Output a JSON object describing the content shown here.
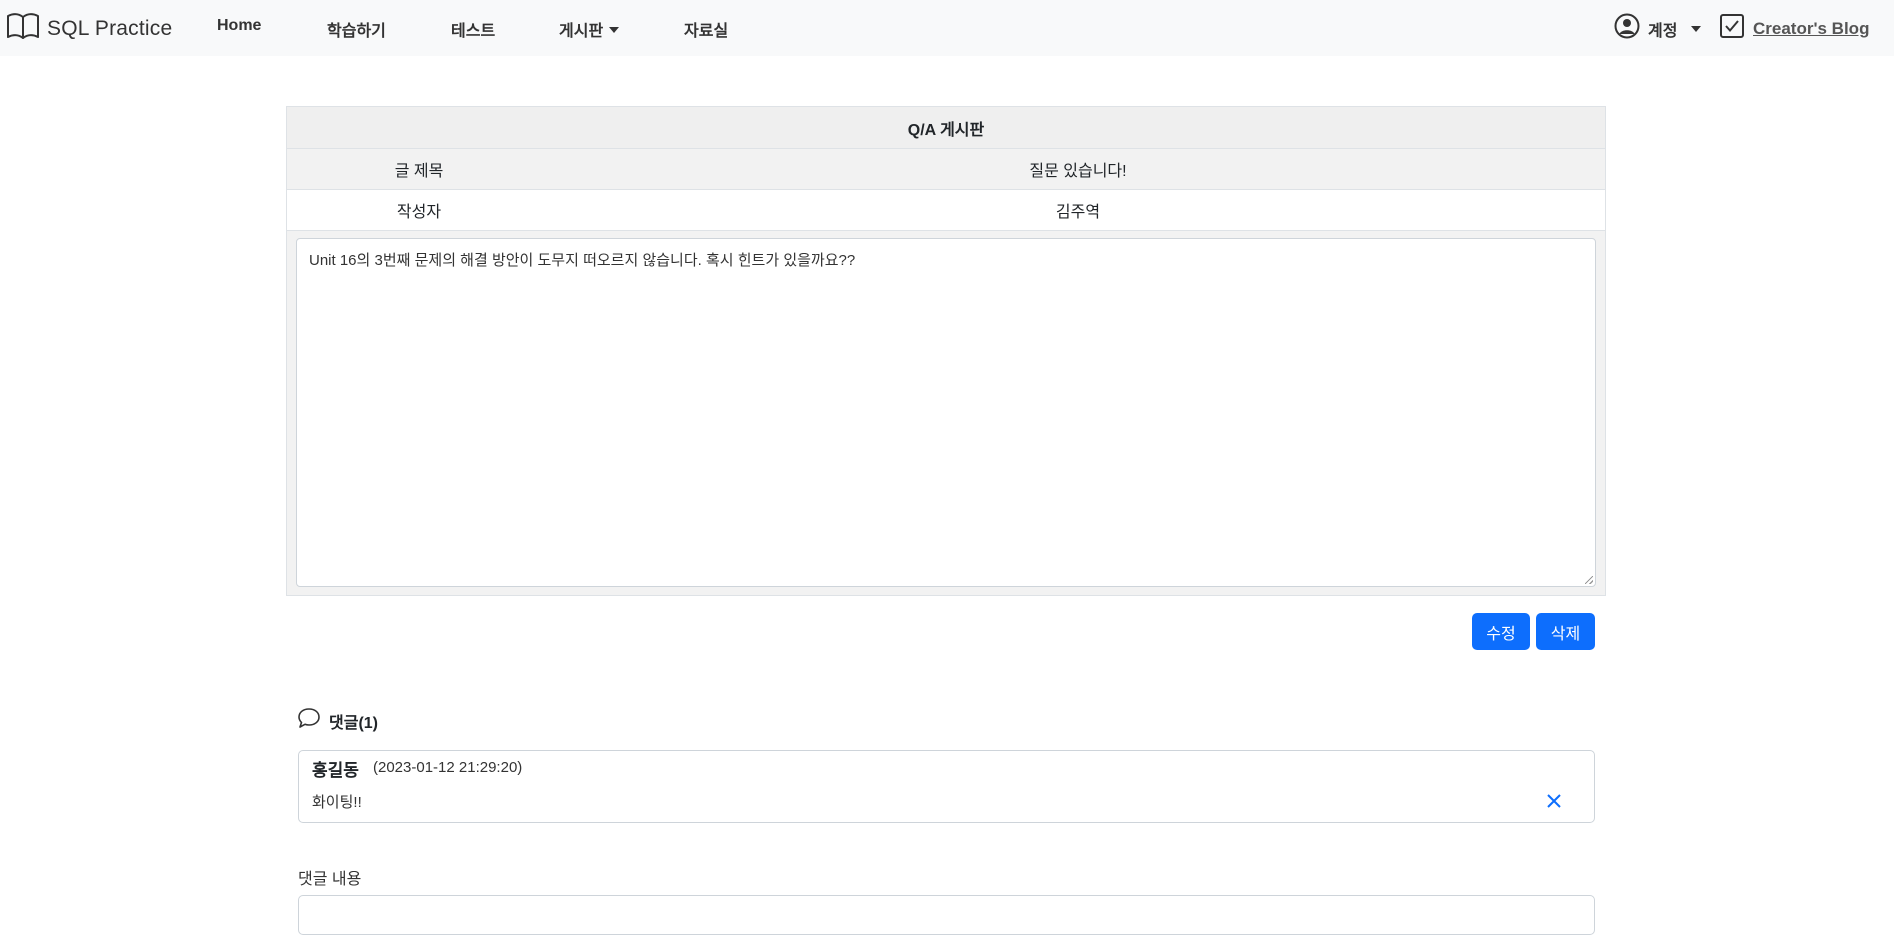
{
  "navbar": {
    "brand": "SQL Practice",
    "items": [
      {
        "label": "Home"
      },
      {
        "label": "학습하기"
      },
      {
        "label": "테스트"
      },
      {
        "label": "게시판"
      },
      {
        "label": "자료실"
      }
    ],
    "account_label": "계정",
    "blog_label": "Creator's Blog"
  },
  "board": {
    "title": "Q/A 게시판",
    "subject_label": "글 제목",
    "subject_value": "질문 있습니다!",
    "author_label": "작성자",
    "author_value": "김주역",
    "content": "Unit 16의 3번째 문제의 해결 방안이 도무지 떠오르지 않습니다. 혹시 힌트가 있을까요??"
  },
  "actions": {
    "edit_label": "수정",
    "delete_label": "삭제"
  },
  "comments": {
    "header": "댓글(1)",
    "items": [
      {
        "author": "홍길동",
        "date": "(2023-01-12 21:29:20)",
        "text": "화이팅!!"
      }
    ]
  },
  "reply": {
    "label": "댓글 내용",
    "value": ""
  },
  "colors": {
    "primary": "#0d6efd",
    "navbar_bg": "#f8f9fa"
  }
}
